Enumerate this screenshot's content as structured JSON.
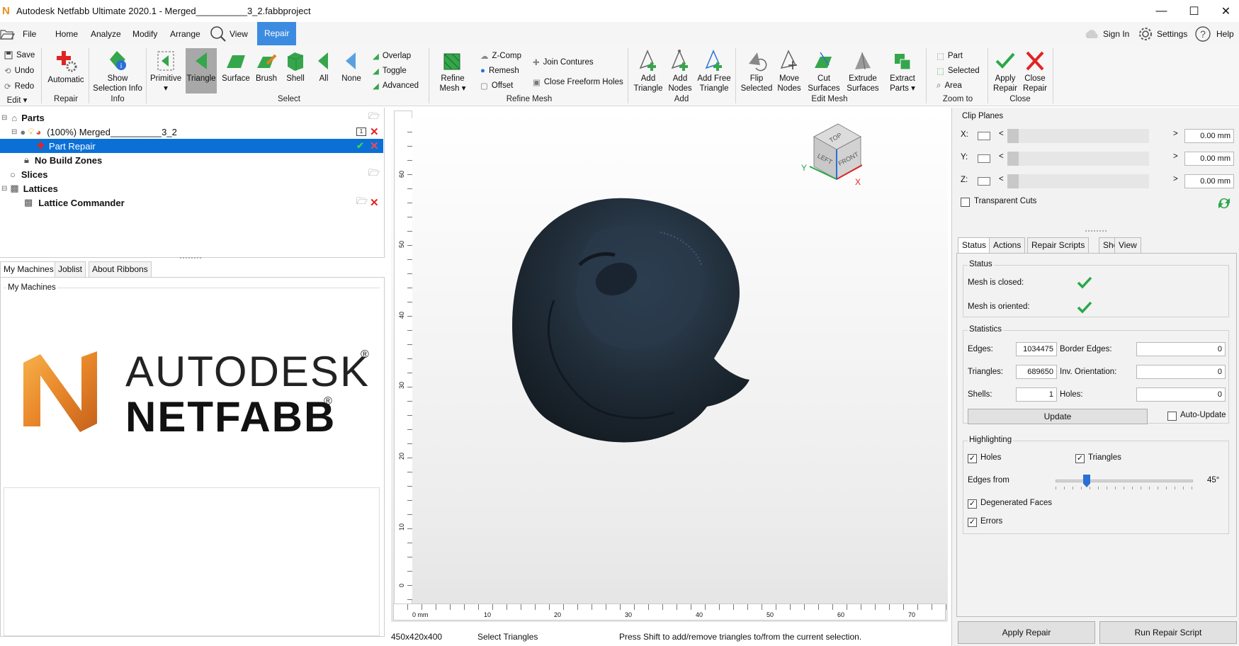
{
  "window": {
    "title": "Autodesk Netfabb Ultimate 2020.1 - Merged__________3_2.fabbproject",
    "minimize": "—",
    "maximize": "☐",
    "close": "✕"
  },
  "menu": {
    "file": "File",
    "home": "Home",
    "analyze": "Analyze",
    "modify": "Modify",
    "arrange": "Arrange",
    "view": "View",
    "repair": "Repair",
    "sign_in": "Sign In",
    "settings": "Settings",
    "help": "Help"
  },
  "ribbon": {
    "edit": {
      "save": "Save",
      "undo": "Undo",
      "redo": "Redo",
      "label": "Edit ▾"
    },
    "repair": {
      "automatic": "Automatic",
      "label": "Repair"
    },
    "info": {
      "show_selection_info_1": "Show",
      "show_selection_info_2": "Selection Info",
      "label": "Info"
    },
    "select": {
      "primitive": "Primitive",
      "triangle": "Triangle",
      "surface": "Surface",
      "brush": "Brush",
      "shell": "Shell",
      "all": "All",
      "none": "None",
      "overlap": "Overlap",
      "toggle": "Toggle",
      "advanced": "Advanced",
      "label": "Select"
    },
    "refine_mesh": {
      "refine_1": "Refine",
      "refine_2": "Mesh ▾",
      "z_comp": "Z-Comp",
      "remesh": "Remesh",
      "offset": "Offset",
      "join_contures": "Join Contures",
      "close_freeform_holes": "Close Freeform Holes",
      "label": "Refine Mesh"
    },
    "add": {
      "add_triangle_1": "Add",
      "add_triangle_2": "Triangle",
      "add_nodes_1": "Add",
      "add_nodes_2": "Nodes",
      "add_free_1": "Add Free",
      "add_free_2": "Triangle",
      "label": "Add"
    },
    "edit_mesh": {
      "flip_1": "Flip",
      "flip_2": "Selected",
      "move_1": "Move",
      "move_2": "Nodes",
      "cut_1": "Cut",
      "cut_2": "Surfaces",
      "extrude_1": "Extrude",
      "extrude_2": "Surfaces",
      "extract_1": "Extract",
      "extract_2": "Parts ▾",
      "label": "Edit Mesh"
    },
    "zoom_to": {
      "part": "Part",
      "selected": "Selected",
      "area": "Area",
      "label": "Zoom to"
    },
    "close": {
      "apply_1": "Apply",
      "apply_2": "Repair",
      "close_1": "Close",
      "close_2": "Repair",
      "label": "Close"
    }
  },
  "tree": {
    "parts": "Parts",
    "merged": "(100%) Merged__________3_2",
    "part_repair": "Part Repair",
    "no_build_zones": "No Build Zones",
    "slices": "Slices",
    "lattices": "Lattices",
    "lattice_commander": "Lattice Commander"
  },
  "left_tabs": {
    "my_machines": "My Machines",
    "joblist": "Joblist",
    "about_ribbons": "About Ribbons"
  },
  "machines": {
    "group_label": "My Machines",
    "brand_1": "AUTODESK",
    "brand_2": "NETFABB",
    "registered": "®"
  },
  "viewport": {
    "cube": {
      "top": "TOP",
      "left": "LEFT",
      "front": "FRONT"
    },
    "axis_x": "X",
    "axis_y": "Y",
    "v_ticks": [
      "0 mm",
      "10",
      "20",
      "30",
      "40",
      "50",
      "60"
    ],
    "h_ticks": [
      "0 mm",
      "10",
      "20",
      "30",
      "40",
      "50",
      "60",
      "70"
    ]
  },
  "statusbar": {
    "dims": "450x420x400",
    "mode": "Select Triangles",
    "hint": "Press Shift to add/remove triangles to/from the current selection."
  },
  "clip_planes": {
    "label": "Clip Planes",
    "x_label": "X:",
    "y_label": "Y:",
    "z_label": "Z:",
    "x_value": "0.00 mm",
    "y_value": "0.00 mm",
    "z_value": "0.00 mm",
    "transparent_cuts": "Transparent Cuts"
  },
  "right_tabs": {
    "status": "Status",
    "actions": "Actions",
    "repair_scripts": "Repair Scripts",
    "shells": "Shells",
    "view": "View"
  },
  "status_group": {
    "label": "Status",
    "mesh_closed": "Mesh is closed:",
    "mesh_oriented": "Mesh is oriented:"
  },
  "statistics": {
    "label": "Statistics",
    "edges_label": "Edges:",
    "edges": "1034475",
    "triangles_label": "Triangles:",
    "triangles": "689650",
    "shells_label": "Shells:",
    "shells": "1",
    "border_edges_label": "Border Edges:",
    "border_edges": "0",
    "inv_orientation_label": "Inv. Orientation:",
    "inv_orientation": "0",
    "holes_label": "Holes:",
    "holes": "0",
    "update": "Update",
    "auto_update": "Auto-Update"
  },
  "highlighting": {
    "label": "Highlighting",
    "holes": "Holes",
    "triangles": "Triangles",
    "edges_from": "Edges from",
    "edges_from_value": "45°",
    "edges_from_level": 0.2,
    "degenerated_faces": "Degenerated Faces",
    "errors": "Errors"
  },
  "bottom_buttons": {
    "apply_repair": "Apply Repair",
    "run_repair_script": "Run Repair Script"
  },
  "colors": {
    "accent": "#3c8be0",
    "selection": "#0a70d6",
    "green": "#2aa84a",
    "red": "#e02424",
    "mesh": "#1c2630"
  }
}
